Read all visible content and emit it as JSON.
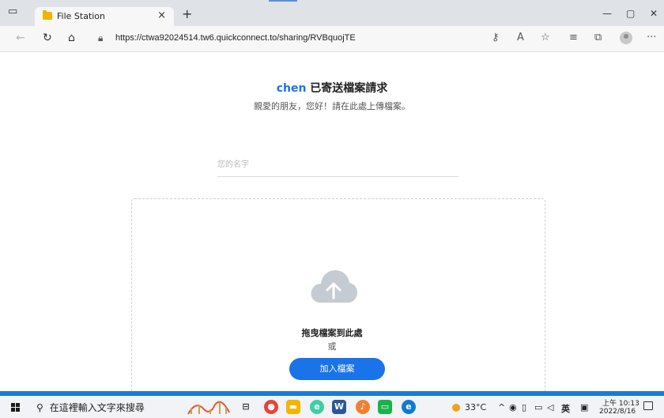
{
  "browser": {
    "tab": {
      "title": "File Station",
      "close": "×"
    },
    "new_tab": "+",
    "window_controls": {
      "minimize": "—",
      "restore": "▢",
      "close": "✕"
    },
    "url": "https://ctwa92024514.tw6.quickconnect.to/sharing/RVBquojTE",
    "icons": [
      "back-icon",
      "refresh-icon",
      "home-icon",
      "lock-icon",
      "key-icon",
      "read-aloud-icon",
      "favorite-icon",
      "favorites-bar-icon",
      "collections-icon",
      "profile-icon",
      "more-icon"
    ]
  },
  "page": {
    "sender_name": "chen",
    "heading_suffix": " 已寄送檔案請求",
    "subtitle": "親愛的朋友，您好！請在此處上傳檔案。",
    "name_placeholder": "您的名字",
    "drop_text": "拖曳檔案到此處",
    "or_text": "或",
    "add_button": "加入檔案",
    "accent_color": "#1a73e8"
  },
  "taskbar": {
    "search_placeholder": "在這裡輸入文字來搜尋",
    "weather": "33°C",
    "ime": "英",
    "time": "上午 10:13",
    "date": "2022/8/16",
    "accent_color": "#1a7ad8"
  }
}
